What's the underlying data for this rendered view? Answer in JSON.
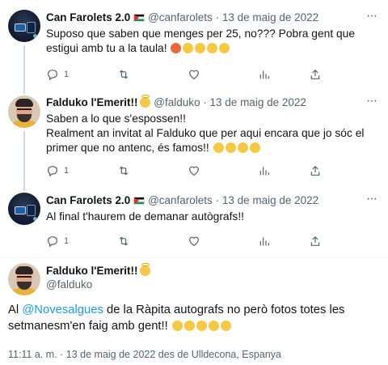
{
  "tweets": [
    {
      "name": "Can Farolets 2.0",
      "handle": "@canfarolets",
      "sep": "·",
      "date": "13 de maig de 2022",
      "text": "Suposo que saben que menges per 25, no??? Pobra gent que estigui amb tu a la taula!",
      "reply_count": "1"
    },
    {
      "name": "Falduko l'Emerit!!",
      "handle": "@falduko",
      "sep": "·",
      "date": "13 de maig de 2022",
      "text_line1": "Saben a lo que s'espossen!!",
      "text_line2": "Realment an invitat al Falduko que per aqui encara que jo sóc el primer que no antenc,  és famos!!",
      "reply_count": "1"
    },
    {
      "name": "Can Farolets 2.0",
      "handle": "@canfarolets",
      "sep": "·",
      "date": "13 de maig de 2022",
      "text": "Al final t'haurem de demanar autògrafs!!",
      "reply_count": "1"
    }
  ],
  "main_tweet": {
    "name": "Falduko l'Emerit!!",
    "handle": "@falduko",
    "text_before": "Al ",
    "mention": "@Novesalgues",
    "text_after": " de la Ràpita autografs no però fotos totes les setmanesm'en faig amb gent!!",
    "timestamp": "11:11 a. m. · 13 de maig de 2022 des de Ulldecona, Espanya"
  },
  "more_icon": "···",
  "icons": [
    "reply-icon",
    "retweet-icon",
    "like-icon",
    "views-icon",
    "share-icon"
  ]
}
